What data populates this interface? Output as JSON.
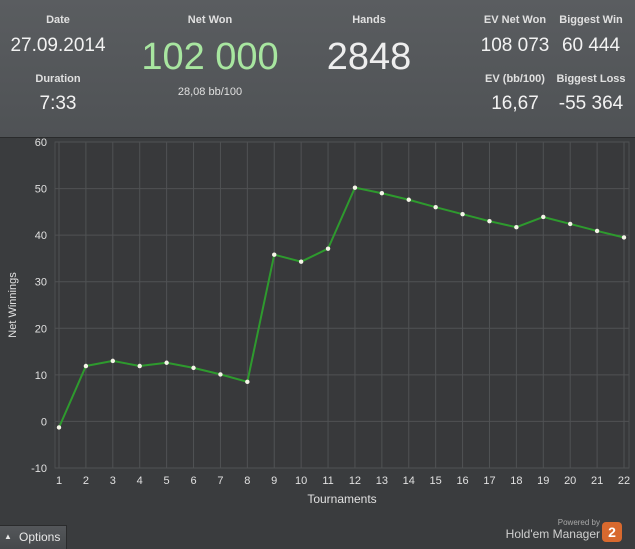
{
  "summary": {
    "date": {
      "label": "Date",
      "value": "27.09.2014"
    },
    "duration": {
      "label": "Duration",
      "value": "7:33"
    },
    "net_won": {
      "label": "Net Won",
      "value": "102 000",
      "sub": "28,08 bb/100"
    },
    "hands": {
      "label": "Hands",
      "value": "2848"
    },
    "ev_net_won": {
      "label": "EV Net Won",
      "value": "108 073"
    },
    "biggest_win": {
      "label": "Biggest Win",
      "value": "60 444"
    },
    "ev_bb100": {
      "label": "EV (bb/100)",
      "value": "16,67"
    },
    "biggest_loss": {
      "label": "Biggest Loss",
      "value": "-55 364"
    }
  },
  "chart_data": {
    "type": "line",
    "xlabel": "Tournaments",
    "ylabel": "Net Winnings",
    "xlim": [
      1,
      22
    ],
    "ylim": [
      -10,
      60
    ],
    "x_ticks": [
      1,
      2,
      3,
      4,
      5,
      6,
      7,
      8,
      9,
      10,
      11,
      12,
      13,
      14,
      15,
      16,
      17,
      18,
      19,
      20,
      21,
      22
    ],
    "y_ticks": [
      -10,
      0,
      10,
      20,
      30,
      40,
      50,
      60
    ],
    "grid": true,
    "line_color": "#2e9a2e",
    "series": [
      {
        "x": [
          1,
          2,
          3,
          4,
          5,
          6,
          7,
          8,
          9,
          10,
          11,
          12,
          13,
          14,
          15,
          16,
          17,
          18,
          19,
          20,
          21,
          22
        ],
        "values": [
          -1.3,
          11.9,
          13.0,
          11.9,
          12.6,
          11.5,
          10.1,
          8.5,
          35.8,
          34.3,
          37.1,
          50.2,
          49.0,
          47.6,
          46.0,
          44.5,
          43.0,
          41.7,
          43.9,
          42.4,
          40.9,
          39.5
        ]
      }
    ]
  },
  "footer": {
    "options_label": "Options",
    "powered_by": "Powered by",
    "brand": "Hold'em Manager",
    "logo_text": "2"
  }
}
